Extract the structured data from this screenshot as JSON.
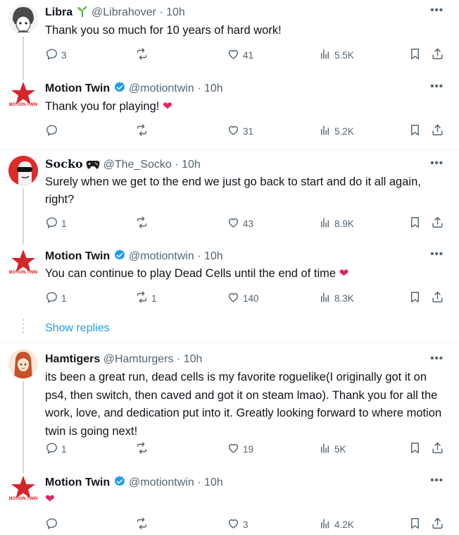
{
  "tweets": [
    {
      "name": "Libra",
      "handle": "@Librahover",
      "time": "· 10h",
      "text": "Thank you so much for 10 years of hard work!",
      "replies": "3",
      "retweets": "",
      "likes": "41",
      "views": "5.5K"
    },
    {
      "name": "Motion Twin",
      "handle": "@motiontwin",
      "time": "· 10h",
      "text": "Thank you for playing!",
      "replies": "",
      "retweets": "",
      "likes": "31",
      "views": "5.2K"
    },
    {
      "name": "Socko",
      "handle": "@The_Socko",
      "time": "· 10h",
      "text": "Surely when we get to the end we just go back to start and do it all again, right?",
      "replies": "1",
      "retweets": "",
      "likes": "43",
      "views": "8.9K"
    },
    {
      "name": "Motion Twin",
      "handle": "@motiontwin",
      "time": "· 10h",
      "text": "You can continue to play Dead Cells until the end of time",
      "replies": "1",
      "retweets": "1",
      "likes": "140",
      "views": "8.3K"
    },
    {
      "name": "Hamtigers",
      "handle": "@Hamturgers",
      "time": "· 10h",
      "text": "its been a great run, dead cells is my favorite roguelike(I originally got it on ps4, then switch, then caved and got it on steam lmao). Thank you for all the work, love, and dedication put into it. Greatly looking forward to where motion twin is going next!",
      "replies": "1",
      "retweets": "",
      "likes": "19",
      "views": "5K"
    },
    {
      "name": "Motion Twin",
      "handle": "@motiontwin",
      "time": "· 10h",
      "text": "",
      "replies": "",
      "retweets": "",
      "likes": "3",
      "views": "4.2K"
    }
  ],
  "show_replies_label": "Show replies",
  "more_label": "•••",
  "motion_twin_logo_text": "MOTION TWIN",
  "colors": {
    "accent": "#1d9bf0",
    "heart": "#e0245e",
    "muted": "#536471",
    "star": "#d6262a"
  }
}
